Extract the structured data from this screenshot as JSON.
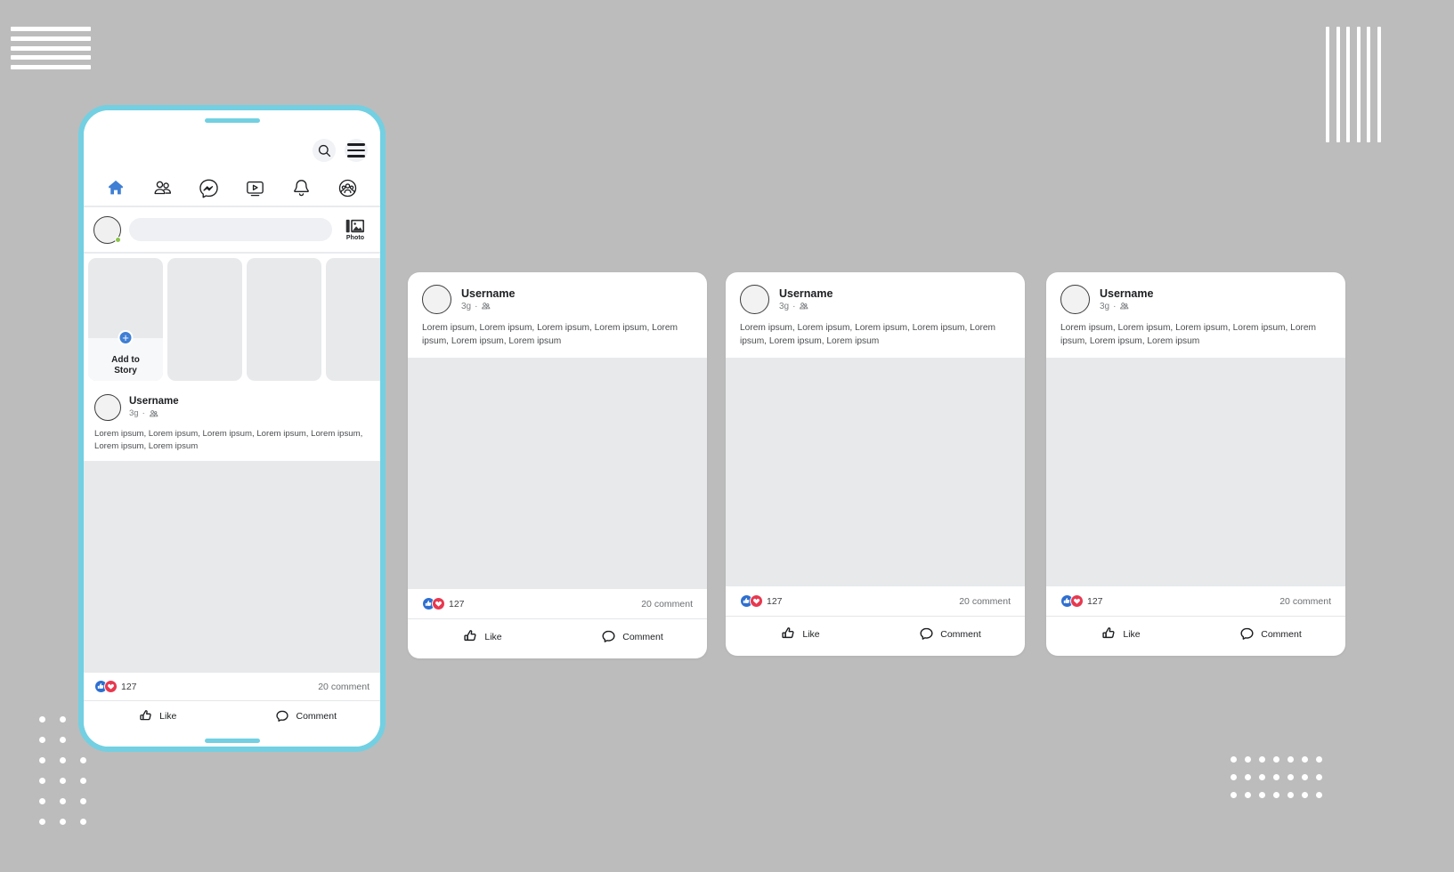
{
  "theme": {
    "page_bg": "#bcbcbc",
    "accent_cyan": "#72d0e2",
    "brand_blue": "#3f7fd4",
    "like_blue": "#2e6fd0",
    "love_red": "#e8384f",
    "placeholder_gray": "#e7e9eb",
    "text_primary": "#1c1e21",
    "text_secondary": "#7a7d80"
  },
  "phone": {
    "topbar": {
      "search_icon": "search-icon",
      "menu_icon": "hamburger-menu-icon"
    },
    "nav": [
      {
        "id": "home",
        "icon": "home-icon",
        "label": "Home",
        "active": true
      },
      {
        "id": "friends",
        "icon": "friends-icon",
        "label": "Friends",
        "active": false
      },
      {
        "id": "messenger",
        "icon": "messenger-icon",
        "label": "Messenger",
        "active": false
      },
      {
        "id": "watch",
        "icon": "video-play-icon",
        "label": "Watch",
        "active": false
      },
      {
        "id": "notifications",
        "icon": "bell-icon",
        "label": "Notifications",
        "active": false
      },
      {
        "id": "groups",
        "icon": "groups-icon",
        "label": "Groups",
        "active": false
      }
    ],
    "composer": {
      "avatar": "user-avatar",
      "placeholder": "",
      "photo_icon": "photo-icon",
      "photo_label": "Photo"
    },
    "stories": {
      "add_plus_icon": "plus-circle-icon",
      "add_label_line1": "Add to",
      "add_label_line2": "Story",
      "items": [
        "add-story",
        "story-1",
        "story-2",
        "story-3"
      ]
    },
    "post": {
      "username": "Username",
      "time": "3g",
      "separator": "·",
      "audience_icon": "friends-audience-icon",
      "text": "Lorem ipsum, Lorem ipsum, Lorem ipsum, Lorem ipsum, Lorem ipsum, Lorem ipsum, Lorem ipsum",
      "reaction_like_icon": "thumbs-up-filled-icon",
      "reaction_love_icon": "heart-filled-icon",
      "reaction_count": "127",
      "comment_count": "20 comment",
      "like_icon": "thumbs-up-outline-icon",
      "like_label": "Like",
      "comment_icon": "speech-bubble-icon",
      "comment_label": "Comment"
    }
  },
  "cards": [
    {
      "id": "post-card-1",
      "username": "Username",
      "time": "3g",
      "separator": "·",
      "audience_icon": "friends-audience-icon",
      "text": "Lorem ipsum, Lorem ipsum, Lorem ipsum, Lorem ipsum, Lorem ipsum, Lorem ipsum, Lorem ipsum",
      "reaction_count": "127",
      "comment_count": "20 comment",
      "like_label": "Like",
      "comment_label": "Comment"
    },
    {
      "id": "post-card-2",
      "username": "Username",
      "time": "3g",
      "separator": "·",
      "audience_icon": "friends-audience-icon",
      "text": "Lorem ipsum, Lorem ipsum, Lorem ipsum, Lorem ipsum, Lorem ipsum, Lorem ipsum, Lorem ipsum",
      "reaction_count": "127",
      "comment_count": "20 comment",
      "like_label": "Like",
      "comment_label": "Comment"
    },
    {
      "id": "post-card-3",
      "username": "Username",
      "time": "3g",
      "separator": "·",
      "audience_icon": "friends-audience-icon",
      "text": "Lorem ipsum, Lorem ipsum, Lorem ipsum, Lorem ipsum, Lorem ipsum, Lorem ipsum, Lorem ipsum",
      "reaction_count": "127",
      "comment_count": "20 comment",
      "like_label": "Like",
      "comment_label": "Comment"
    }
  ],
  "decorations": {
    "top_left_stripes": 5,
    "top_right_stripes": 6,
    "bottom_left_dots_cols": 3,
    "bottom_left_dots_rows": 6,
    "bottom_right_dots_cols": 7,
    "bottom_right_dots_rows": 3
  }
}
